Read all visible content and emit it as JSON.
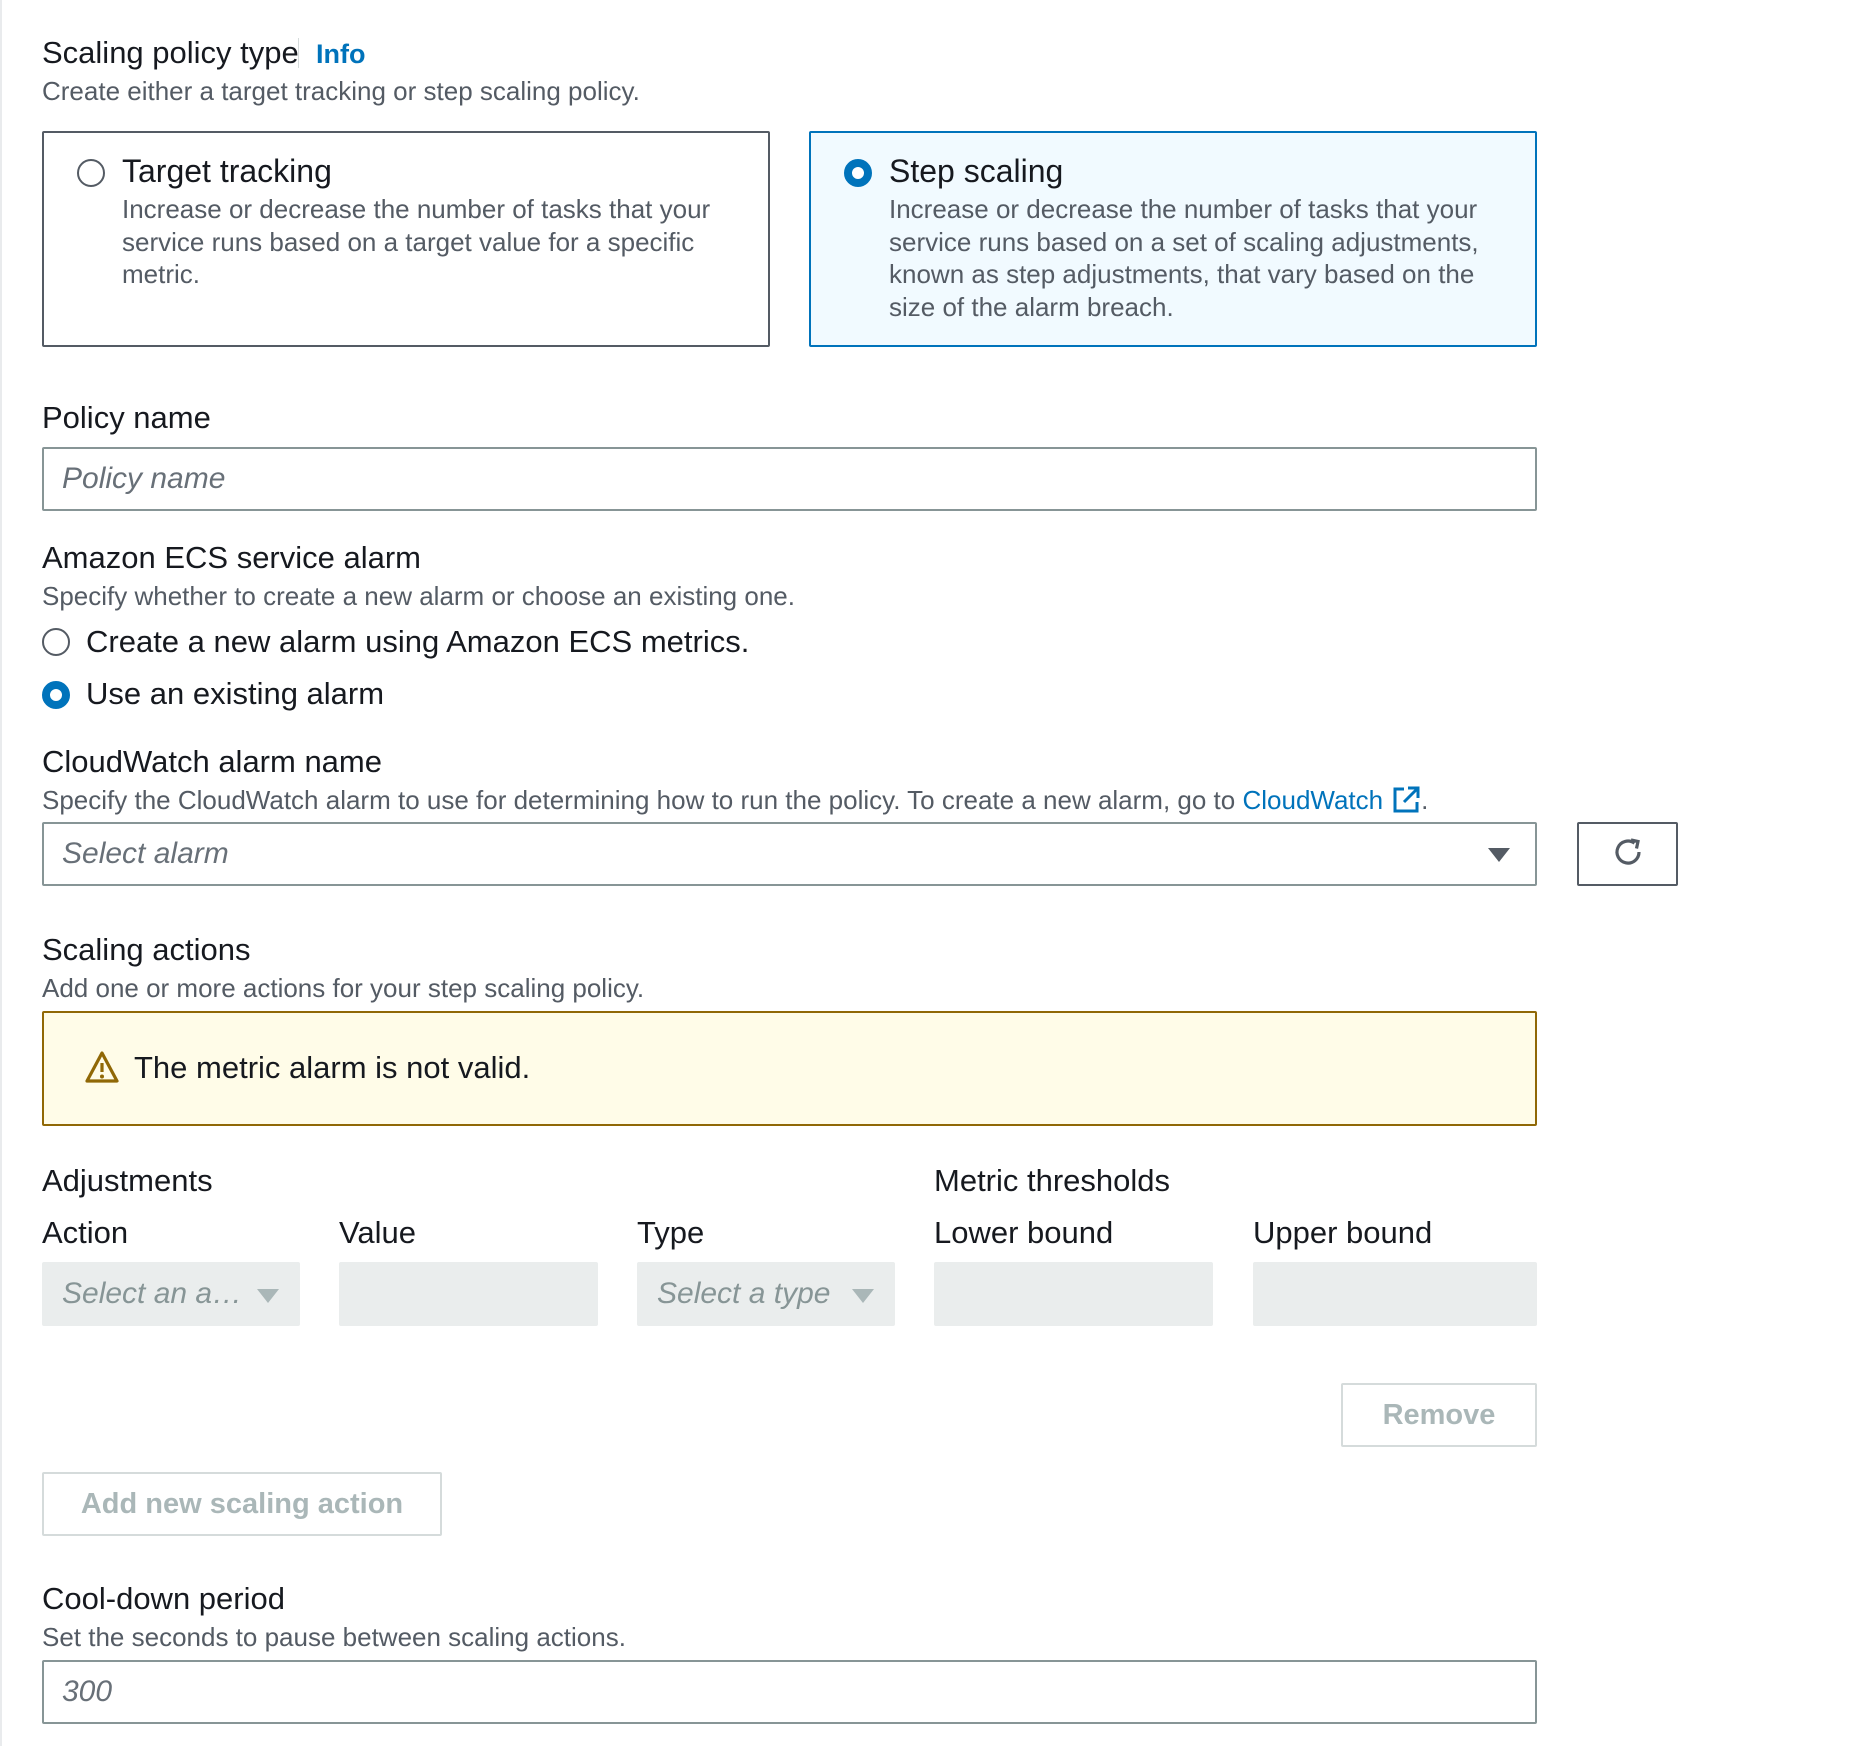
{
  "scaling_policy_type": {
    "label": "Scaling policy type",
    "info_link": "Info",
    "description": "Create either a target tracking or step scaling policy.",
    "options": [
      {
        "title": "Target tracking",
        "description": "Increase or decrease the number of tasks that your service runs based on a target value for a specific metric.",
        "selected": false
      },
      {
        "title": "Step scaling",
        "description": "Increase or decrease the number of tasks that your service runs based on a set of scaling adjustments, known as step adjustments, that vary based on the size of the alarm breach.",
        "selected": true
      }
    ]
  },
  "policy_name": {
    "label": "Policy name",
    "placeholder": "Policy name",
    "value": ""
  },
  "service_alarm": {
    "label": "Amazon ECS service alarm",
    "description": "Specify whether to create a new alarm or choose an existing one.",
    "options": [
      {
        "label": "Create a new alarm using Amazon ECS metrics.",
        "selected": false
      },
      {
        "label": "Use an existing alarm",
        "selected": true
      }
    ]
  },
  "cloudwatch_alarm": {
    "label": "CloudWatch alarm name",
    "description_prefix": "Specify the CloudWatch alarm to use for determining how to run the policy. To create a new alarm, go to ",
    "link_text": "CloudWatch",
    "description_suffix": ".",
    "select_placeholder": "Select alarm",
    "refresh_icon": "refresh-icon",
    "external_icon": "external-link-icon"
  },
  "scaling_actions": {
    "label": "Scaling actions",
    "description": "Add one or more actions for your step scaling policy.",
    "alert_text": "The metric alarm is not valid.",
    "alert_icon": "warning-icon",
    "adjustments_label": "Adjustments",
    "metric_thresholds_label": "Metric thresholds",
    "columns": {
      "action": "Action",
      "value": "Value",
      "type": "Type",
      "lower_bound": "Lower bound",
      "upper_bound": "Upper bound"
    },
    "action_placeholder": "Select an a…",
    "type_placeholder": "Select a type",
    "remove_button": "Remove",
    "add_button": "Add new scaling action"
  },
  "cooldown": {
    "label": "Cool-down period",
    "description": "Set the seconds to pause between scaling actions.",
    "placeholder": "300"
  },
  "colors": {
    "accent": "#0073bb",
    "selected_tile_bg": "#f1faff",
    "warning_border": "#906806",
    "warning_bg": "#fffce8",
    "disabled_bg": "#eaeded"
  }
}
